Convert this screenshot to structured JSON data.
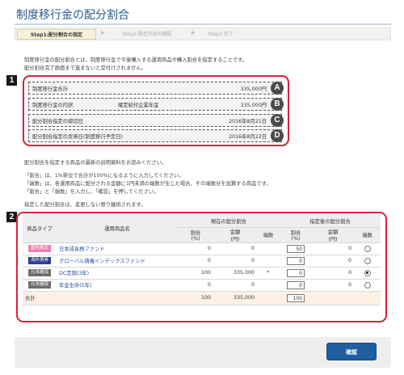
{
  "page": {
    "title": "制度移行金の配分割合"
  },
  "steps": [
    {
      "label": "Step1:配分割合の指定"
    },
    {
      "label": "Step2:指定内容の確認"
    },
    {
      "label": "Step3:完了"
    }
  ],
  "intro": {
    "line1": "制度移行金の配分割合とは、制度移行金で今後購入する運用商品や購入割合を指定することです。",
    "line2": "配分割合完了画面まで進まないと受付けされません。"
  },
  "markers": {
    "box1": "1",
    "box2": "2"
  },
  "info": [
    {
      "label": "制度移行金合計",
      "sub": "",
      "value": "335,000円",
      "letter": "A"
    },
    {
      "label": "制度移行金の内訳",
      "sub": "確定給付企業年金",
      "value": "335,000円",
      "letter": "B"
    },
    {
      "label": "配分割合指定の締切日",
      "sub": "",
      "value": "2016年8月21日",
      "letter": "C"
    },
    {
      "label": "配分割合指定の反映日(制度移行予定日)",
      "sub": "",
      "value": "2016年8月22日",
      "letter": "D"
    }
  ],
  "notes": {
    "line1": "配分割合を指定する商品の最新の説明資料をお読みください。",
    "line2": "「割合」は、1%単位で合計が100%になるように入力してください。",
    "line3": "「端数」は、各運用商品に配分される金額に1円未満の端数が生じた場合、その端数分を加算する商品です。",
    "line4": "「割合」と「端数」を入力し、「確認」を押してください。",
    "line5": "指定した配分割合は、変更しない限り継続されます。"
  },
  "table": {
    "headers": {
      "type": "商品タイプ",
      "name": "運用商品名",
      "current": "現在の配分割合",
      "after": "指定後の配分割合",
      "ratio": "割合",
      "ratio_unit": "(%)",
      "amount": "金額",
      "amount_unit": "(円)",
      "fraction": "端数"
    },
    "rows": [
      {
        "type": "国内株式",
        "type_color": "#f07fae",
        "name": "日本成長株ファンド",
        "cur_ratio": "0",
        "cur_amount": "0",
        "cur_frac": "",
        "new_ratio": "50",
        "new_amount": "0",
        "selected": false
      },
      {
        "type": "海外債券",
        "type_color": "#2c3f8f",
        "name": "グローバル債権インデックスファンド",
        "cur_ratio": "0",
        "cur_amount": "0",
        "cur_frac": "",
        "new_ratio": "0",
        "new_amount": "0",
        "selected": false
      },
      {
        "type": "元本確保",
        "type_color": "#6f6f6f",
        "name": "DC定期(3年)",
        "cur_ratio": "100",
        "cur_amount": "335,000",
        "cur_frac": "*",
        "new_ratio": "0",
        "new_amount": "0",
        "selected": true
      },
      {
        "type": "元本確保",
        "type_color": "#6f6f6f",
        "name": "年金生命(5年)",
        "cur_ratio": "0",
        "cur_amount": "0",
        "cur_frac": "",
        "new_ratio": "0",
        "new_amount": "0",
        "selected": false
      }
    ],
    "total": {
      "label": "合計",
      "cur_ratio": "100",
      "cur_amount": "335,000",
      "new_ratio": "100"
    }
  },
  "actions": {
    "confirm_label": "確認"
  },
  "colors": {
    "accent": "#2a5b8c",
    "highlight": "#d9203a",
    "button": "#1f5e9f"
  }
}
